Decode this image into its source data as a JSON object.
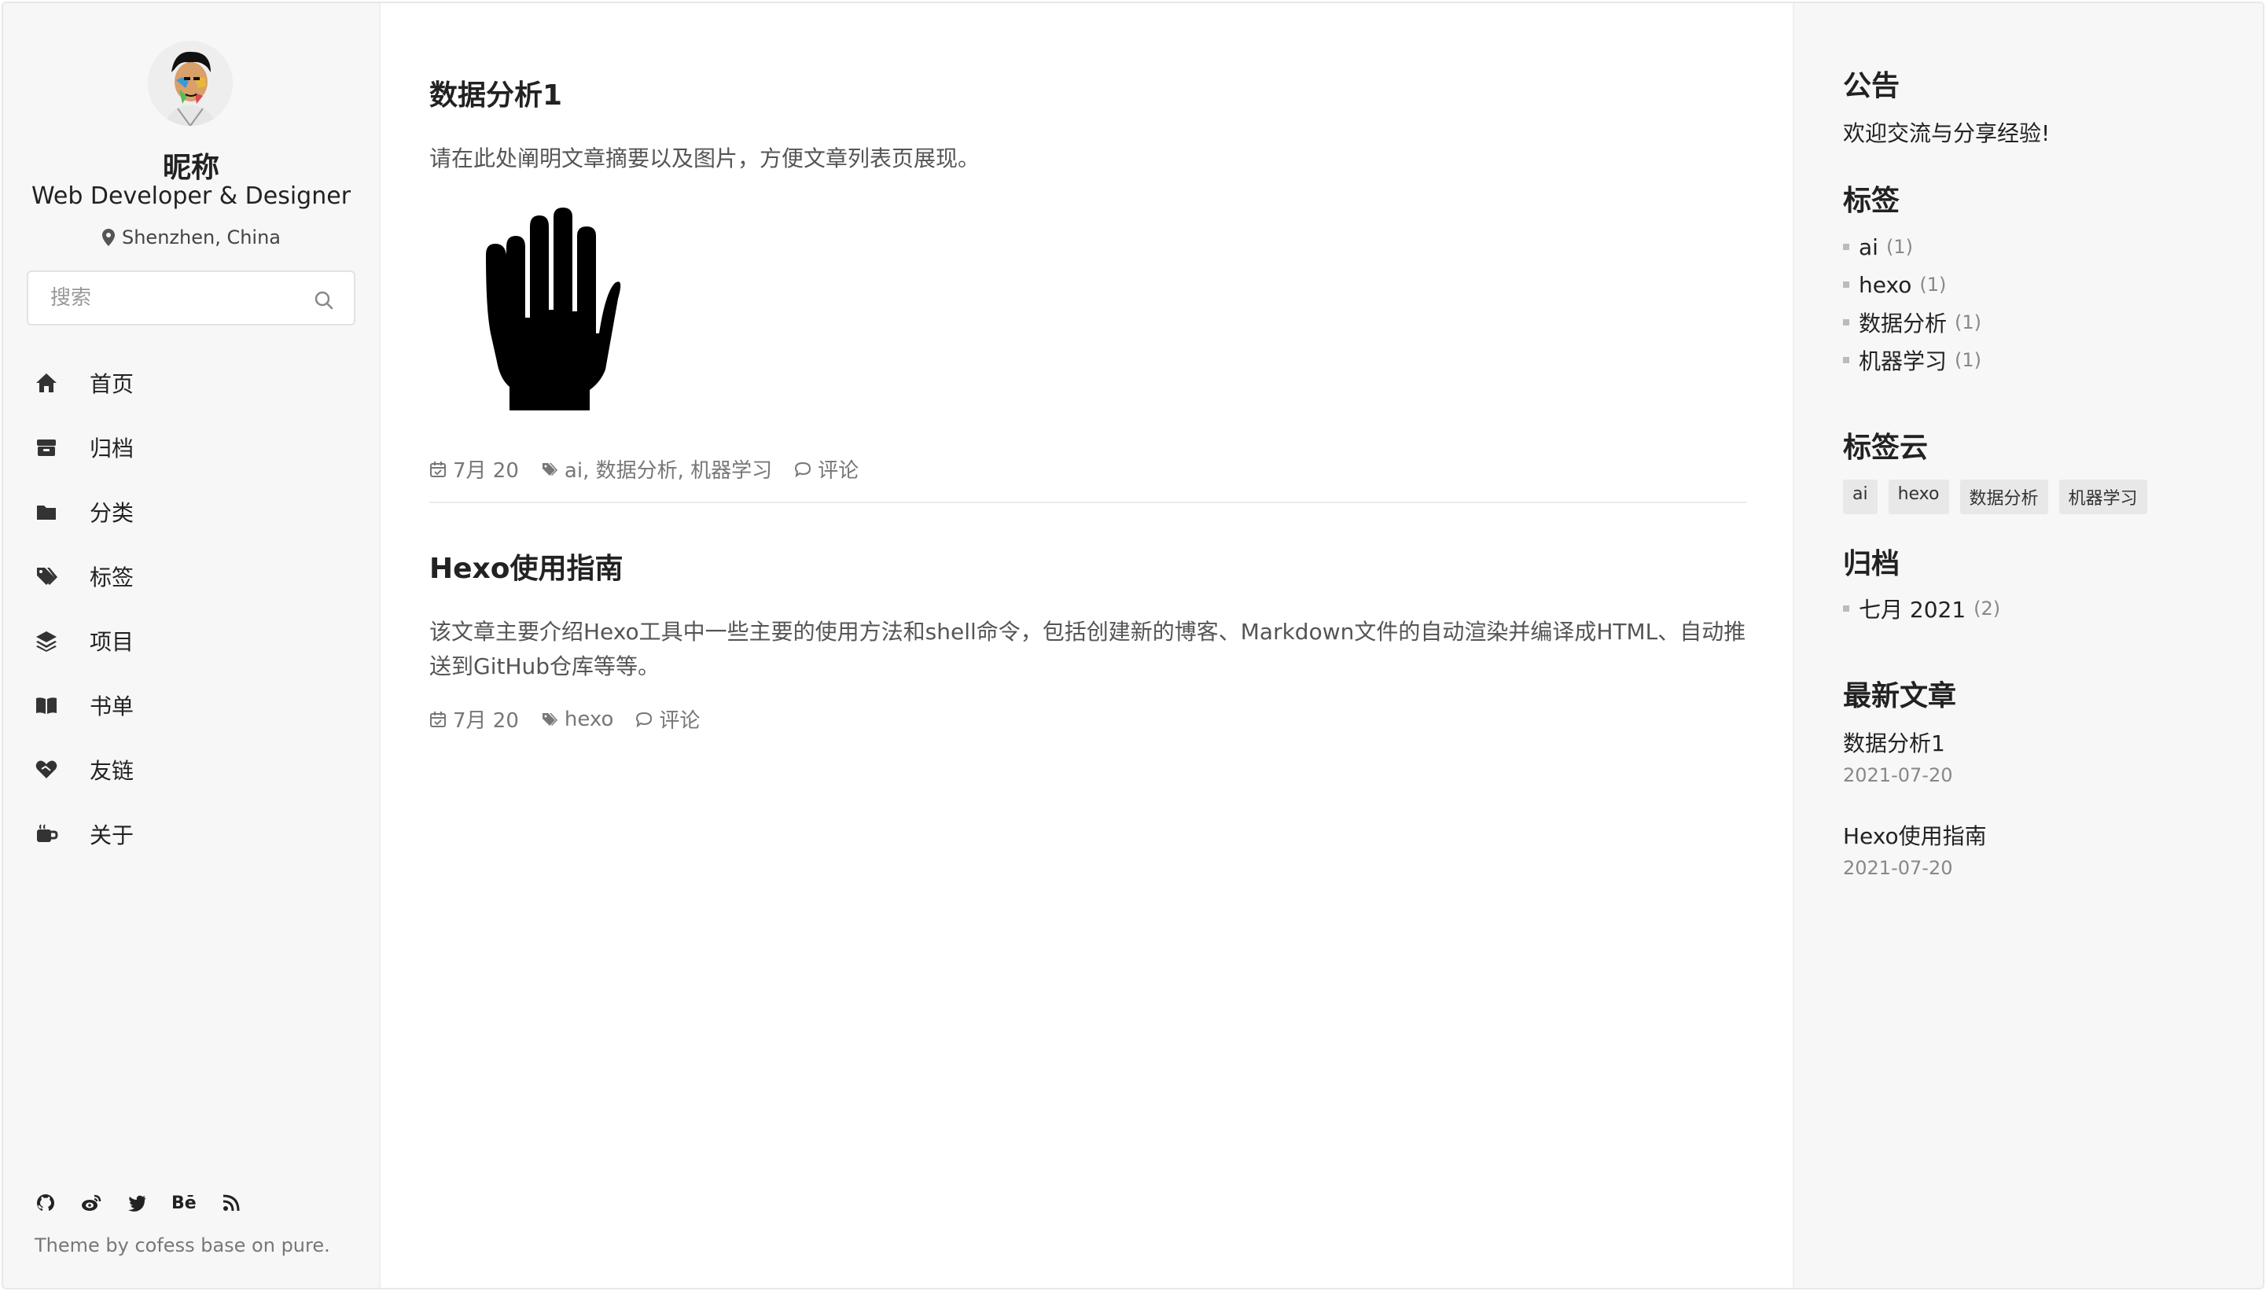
{
  "sidebar": {
    "nickname": "昵称",
    "role": "Web Developer & Designer",
    "location": "Shenzhen, China",
    "search_placeholder": "搜索",
    "nav": [
      {
        "label": "首页",
        "icon": "home-icon"
      },
      {
        "label": "归档",
        "icon": "archive-icon"
      },
      {
        "label": "分类",
        "icon": "folder-icon"
      },
      {
        "label": "标签",
        "icon": "tags-icon"
      },
      {
        "label": "项目",
        "icon": "layers-icon"
      },
      {
        "label": "书单",
        "icon": "book-icon"
      },
      {
        "label": "友链",
        "icon": "handshake-icon"
      },
      {
        "label": "关于",
        "icon": "coffee-icon"
      }
    ],
    "social": [
      "github-icon",
      "weibo-icon",
      "twitter-icon",
      "behance-icon",
      "rss-icon"
    ],
    "behance_text": "Bē",
    "footer": "Theme by cofess base on pure."
  },
  "posts": [
    {
      "title": "数据分析1",
      "excerpt": "请在此处阐明文章摘要以及图片，方便文章列表页展现。",
      "image": "hand-icon",
      "date": "7月 20",
      "tags": "ai, 数据分析, 机器学习",
      "comment": "评论"
    },
    {
      "title": "Hexo使用指南",
      "excerpt": "该文章主要介绍Hexo工具中一些主要的使用方法和shell命令，包括创建新的博客、Markdown文件的自动渲染并编译成HTML、自动推送到GitHub仓库等等。",
      "date": "7月 20",
      "tags": "hexo",
      "comment": "评论"
    }
  ],
  "right": {
    "notice_title": "公告",
    "notice_text": "欢迎交流与分享经验!",
    "tags_title": "标签",
    "tags": [
      {
        "name": "ai",
        "count": "(1)"
      },
      {
        "name": "hexo",
        "count": "(1)"
      },
      {
        "name": "数据分析",
        "count": "(1)"
      },
      {
        "name": "机器学习",
        "count": "(1)"
      }
    ],
    "cloud_title": "标签云",
    "cloud": [
      "ai",
      "hexo",
      "数据分析",
      "机器学习"
    ],
    "archive_title": "归档",
    "archives": [
      {
        "name": "七月 2021",
        "count": "(2)"
      }
    ],
    "recent_title": "最新文章",
    "recent": [
      {
        "title": "数据分析1",
        "date": "2021-07-20"
      },
      {
        "title": "Hexo使用指南",
        "date": "2021-07-20"
      }
    ]
  }
}
